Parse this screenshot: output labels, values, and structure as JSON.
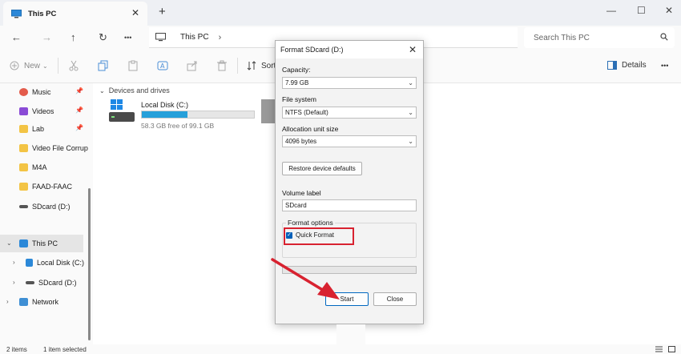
{
  "window": {
    "tab_title": "This PC",
    "tab_close": "✕",
    "new_tab": "+",
    "minimize": "—",
    "maximize": "☐",
    "close": "✕"
  },
  "address_bar": {
    "back": "←",
    "forward": "→",
    "up": "↑",
    "refresh": "↻",
    "more": "•••",
    "crumb": "This PC",
    "chevron": "›",
    "search_placeholder": "Search This PC"
  },
  "toolbar": {
    "new_label": "New",
    "new_caret": "⌄",
    "sort_label": "Sort",
    "details_label": "Details",
    "more": "•••"
  },
  "sidebar": {
    "quick_access": [
      {
        "label": "Music",
        "icon": "music-icon",
        "pinned": true,
        "color": "#e35b4b"
      },
      {
        "label": "Videos",
        "icon": "videos-icon",
        "pinned": true,
        "color": "#8a4bd6"
      },
      {
        "label": "Lab",
        "icon": "folder-icon",
        "pinned": true,
        "color": "#f3c445"
      },
      {
        "label": "Video File Corrup",
        "icon": "folder-icon",
        "pinned": false,
        "color": "#f3c445"
      },
      {
        "label": "M4A",
        "icon": "folder-icon",
        "pinned": false,
        "color": "#f3c445"
      },
      {
        "label": "FAAD-FAAC",
        "icon": "folder-icon",
        "pinned": false,
        "color": "#f3c445"
      },
      {
        "label": "SDcard (D:)",
        "icon": "drive-icon",
        "pinned": false,
        "color": "#555555"
      }
    ],
    "tree": [
      {
        "label": "This PC",
        "icon": "pc-icon",
        "expanded": true,
        "selected": true
      },
      {
        "label": "Local Disk (C:)",
        "icon": "drive-icon",
        "expanded": false
      },
      {
        "label": "SDcard (D:)",
        "icon": "drive-icon",
        "expanded": false
      },
      {
        "label": "Network",
        "icon": "network-icon",
        "expanded": false
      }
    ]
  },
  "main": {
    "section_header": "Devices and drives",
    "section_caret": "⌄",
    "drives": [
      {
        "name": "Local Disk (C:)",
        "free_text": "58.3 GB free of 99.1 GB",
        "used_fraction": 0.41,
        "bar_color": "#26a0da"
      }
    ]
  },
  "status": {
    "items": "2 items",
    "selected": "1 item selected"
  },
  "dialog": {
    "title": "Format SDcard (D:)",
    "close": "✕",
    "capacity_label": "Capacity:",
    "capacity_value": "7.99 GB",
    "filesystem_label": "File system",
    "filesystem_value": "NTFS (Default)",
    "allocation_label": "Allocation unit size",
    "allocation_value": "4096 bytes",
    "restore_button": "Restore device defaults",
    "volume_label_label": "Volume label",
    "volume_label_value": "SDcard",
    "format_options_label": "Format options",
    "quick_format_label": "Quick Format",
    "quick_format_checked": true,
    "progress_fraction": 0,
    "start_button": "Start",
    "close_button": "Close",
    "dropdown_caret": "⌄",
    "highlight_color": "#d82230"
  }
}
